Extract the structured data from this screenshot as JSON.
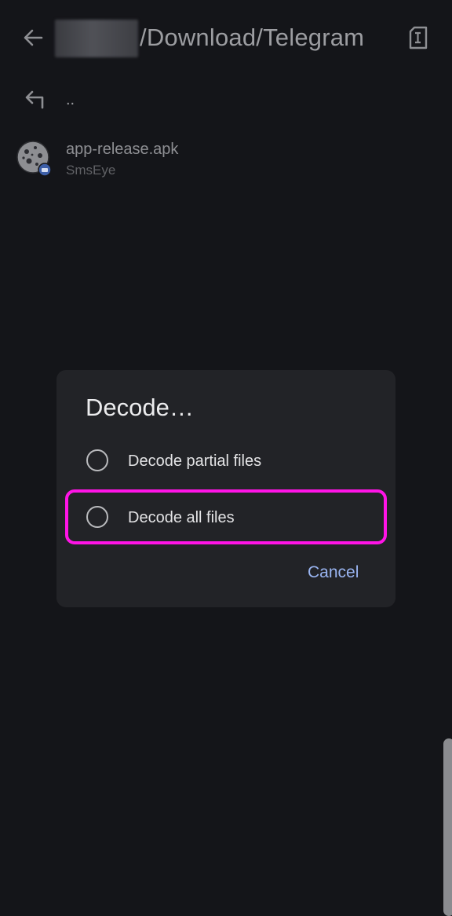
{
  "header": {
    "path_suffix": "/Download/Telegram",
    "back_icon": "arrow-left-icon",
    "action_icon": "text-document-icon"
  },
  "file_list": {
    "parent_label": "..",
    "files": [
      {
        "name": "app-release.apk",
        "subtitle": "SmsEye",
        "icon": "apk-cookie-icon"
      }
    ]
  },
  "dialog": {
    "title": "Decode…",
    "options": [
      {
        "label": "Decode partial files",
        "selected": false
      },
      {
        "label": "Decode all files",
        "selected": false,
        "highlighted": true
      }
    ],
    "cancel_label": "Cancel"
  },
  "colors": {
    "background": "#141519",
    "dialog_bg": "#222327",
    "accent": "#9ab5f2",
    "highlight": "#ff14e6"
  }
}
